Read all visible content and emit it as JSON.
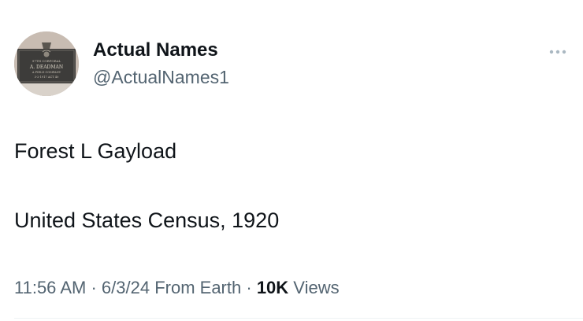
{
  "tweet": {
    "author": {
      "name": "Actual Names",
      "handle": "@ActualNames1",
      "avatar_plaque": {
        "line1": "97TH CORPORAL",
        "line2": "A. DEADMAN",
        "line3": "A FIELD COMPANY",
        "line4": "3-2-1917 ACT 40"
      }
    },
    "more_icon": "more-horizontal-icon",
    "text_lines": [
      "Forest L Gayload",
      "United States Census, 1920"
    ],
    "meta": {
      "time": "11:56 AM",
      "separator": "·",
      "date": "6/3/24",
      "source": "From Earth",
      "views_count": "10K",
      "views_label": "Views"
    }
  },
  "colors": {
    "primary_text": "#0f1419",
    "secondary_text": "#536471",
    "divider": "#eff3f4"
  }
}
